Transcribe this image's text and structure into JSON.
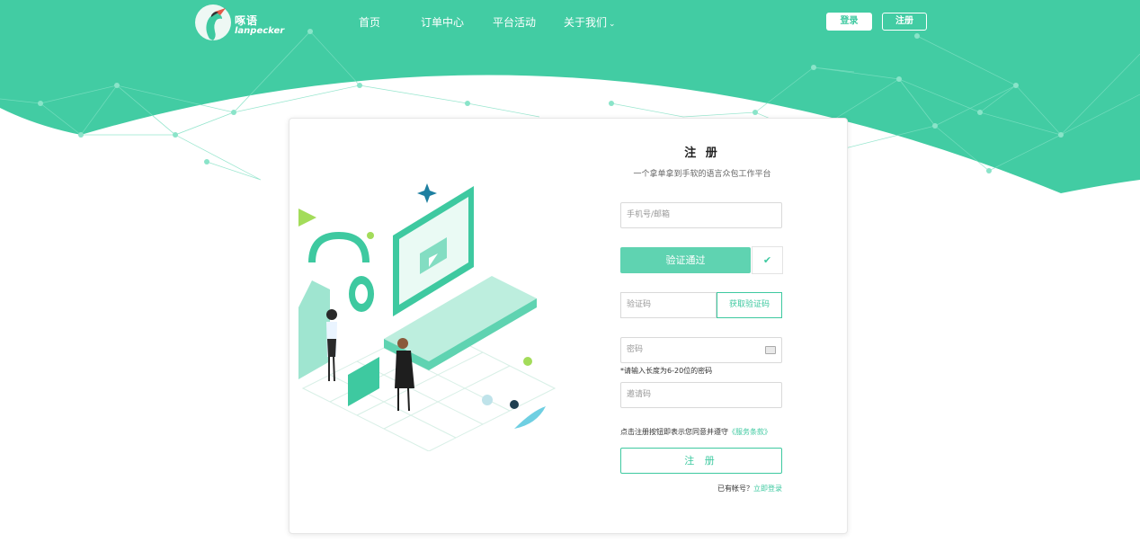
{
  "brand": {
    "name_cn": "啄语",
    "name_en": "lanpecker"
  },
  "nav": {
    "items": [
      {
        "label": "首页"
      },
      {
        "label": "订单中心"
      },
      {
        "label": "平台活动"
      },
      {
        "label": "关于我们"
      }
    ]
  },
  "header_actions": {
    "login": "登录",
    "register": "注册"
  },
  "form": {
    "title": "注 册",
    "subtitle": "一个拿单拿到手软的语言众包工作平台",
    "phone_placeholder": "手机号/邮箱",
    "verify_status": "验证通过",
    "code_placeholder": "验证码",
    "get_code": "获取验证码",
    "password_placeholder": "密码",
    "password_hint": "*请输入长度为6-20位的密码",
    "invite_placeholder": "邀请码",
    "agree_text": "点击注册按钮即表示您同意并遵守",
    "agree_link": "《服务条款》",
    "submit": "注 册",
    "have_account": "已有帐号？",
    "login_link": "立即登录"
  },
  "icons": {
    "check": "check-icon",
    "keyboard": "keyboard-icon",
    "chevron": "chevron-down-icon"
  },
  "colors": {
    "accent": "#42cca3",
    "accent_light": "#5fd3b1"
  }
}
